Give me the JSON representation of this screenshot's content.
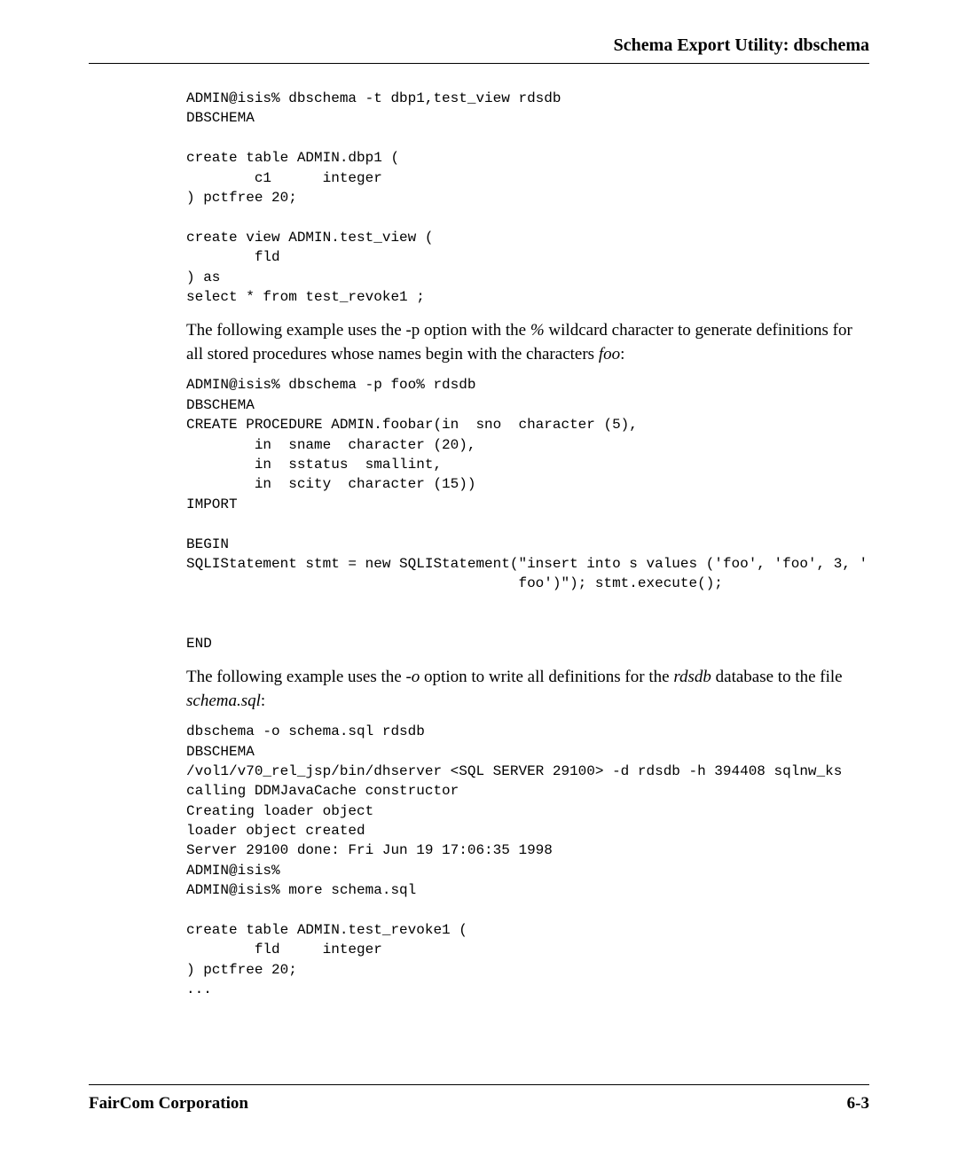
{
  "header": {
    "title": "Schema Export Utility: dbschema"
  },
  "code1": "ADMIN@isis% dbschema -t dbp1,test_view rdsdb\nDBSCHEMA\n\ncreate table ADMIN.dbp1 (\n        c1      integer\n) pctfree 20;\n\ncreate view ADMIN.test_view (\n        fld\n) as\nselect * from test_revoke1 ;",
  "para1": {
    "pre": "The following example uses the -p option with the ",
    "wild": "%",
    "mid": " wildcard character to generate definitions for all stored procedures whose names begin with the characters ",
    "foo": "foo",
    "post": ":"
  },
  "code2": "ADMIN@isis% dbschema -p foo% rdsdb\nDBSCHEMA\nCREATE PROCEDURE ADMIN.foobar(in  sno  character (5),\n        in  sname  character (20),\n        in  sstatus  smallint,\n        in  scity  character (15))\nIMPORT\n\nBEGIN\nSQLIStatement stmt = new SQLIStatement(\"insert into s values ('foo', 'foo', 3, '\n                                       foo')\"); stmt.execute();\n\n\nEND",
  "para2": {
    "pre": "The following example uses the ",
    "opt": "-o",
    "mid1": " option to write all definitions for the ",
    "db": "rdsdb",
    "mid2": " database to the file ",
    "file": "schema.sql",
    "post": ":"
  },
  "code3": "dbschema -o schema.sql rdsdb\nDBSCHEMA\n/vol1/v70_rel_jsp/bin/dhserver <SQL SERVER 29100> -d rdsdb -h 394408 sqlnw_ks\ncalling DDMJavaCache constructor\nCreating loader object\nloader object created\nServer 29100 done: Fri Jun 19 17:06:35 1998\nADMIN@isis%\nADMIN@isis% more schema.sql\n\ncreate table ADMIN.test_revoke1 (\n        fld     integer\n) pctfree 20;\n...",
  "footer": {
    "company": "FairCom Corporation",
    "page": "6-3"
  }
}
